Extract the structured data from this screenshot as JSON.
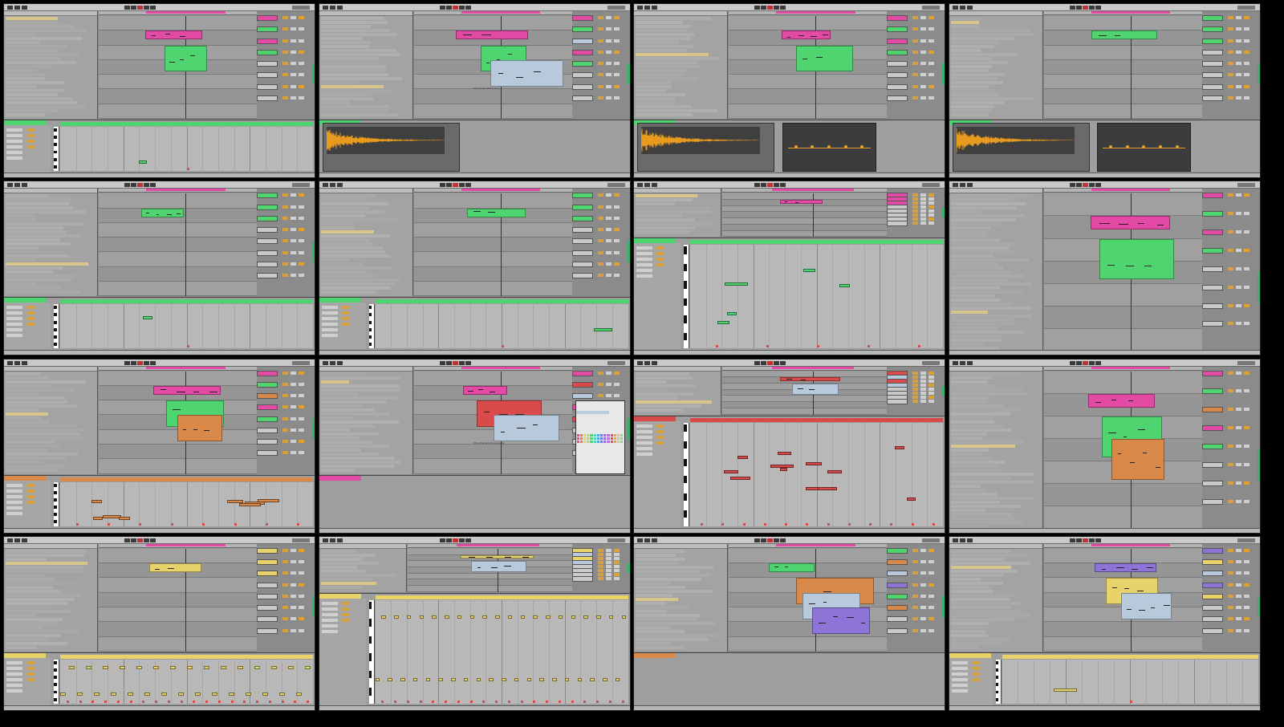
{
  "grid": {
    "cols": 4,
    "rows": 4
  },
  "colors": {
    "pink": "#e24aa5",
    "green": "#4fd56f",
    "orange": "#d8894a",
    "red": "#d94a4a",
    "yellow": "#e7d36a",
    "violet": "#8f74d8",
    "lightblue": "#b9c9dc",
    "tan": "#d8c58c",
    "panel": "#8b8b8b",
    "waveform": "#e79a1d"
  },
  "screens": [
    {
      "id": 1,
      "accent": "green",
      "detail": "midi",
      "clips": [
        "pink",
        "green"
      ],
      "pianoNotes": 1
    },
    {
      "id": 2,
      "accent": "green",
      "detail": "sample",
      "clips": [
        "pink",
        "green",
        "lightblue"
      ],
      "hint": "Drop Audio Effects Here"
    },
    {
      "id": 3,
      "accent": "green",
      "detail": "sample-eq",
      "clips": [
        "pink",
        "green"
      ]
    },
    {
      "id": 4,
      "accent": "green",
      "detail": "sample-eq",
      "clips": [
        "green"
      ]
    },
    {
      "id": 5,
      "accent": "green",
      "detail": "midi",
      "clips": [
        "green"
      ],
      "pianoNotes": 1
    },
    {
      "id": 6,
      "accent": "green",
      "detail": "midi",
      "clips": [
        "green"
      ],
      "pianoNotes": 1
    },
    {
      "id": 7,
      "accent": "green",
      "detail": "piano-full",
      "clips": [
        "pink"
      ],
      "pianoNotes": 5
    },
    {
      "id": 8,
      "accent": "green",
      "detail": "none",
      "clips": [
        "pink",
        "green"
      ]
    },
    {
      "id": 9,
      "accent": "orange",
      "detail": "midi",
      "clips": [
        "pink",
        "green",
        "orange"
      ],
      "pianoNotes": 8
    },
    {
      "id": 10,
      "accent": "pink",
      "detail": "empty",
      "clips": [
        "pink",
        "red",
        "lightblue"
      ],
      "contextMenu": true,
      "hint": "Drop Files and Devices Here"
    },
    {
      "id": 11,
      "accent": "red",
      "detail": "piano-full",
      "clips": [
        "red",
        "lightblue"
      ],
      "pianoNotes": 12
    },
    {
      "id": 12,
      "accent": "pink",
      "detail": "none",
      "clips": [
        "pink",
        "green",
        "orange"
      ]
    },
    {
      "id": 13,
      "accent": "yellow",
      "detail": "midi",
      "clips": [
        "yellow"
      ],
      "pianoNotes": 30
    },
    {
      "id": 14,
      "accent": "yellow",
      "detail": "piano-full",
      "clips": [
        "yellow",
        "lightblue"
      ],
      "pianoNotes": 40
    },
    {
      "id": 15,
      "accent": "orange",
      "detail": "empty",
      "clips": [
        "green",
        "orange",
        "lightblue",
        "violet"
      ]
    },
    {
      "id": 16,
      "accent": "yellow",
      "detail": "midi-small",
      "clips": [
        "violet",
        "yellow",
        "lightblue"
      ]
    }
  ]
}
